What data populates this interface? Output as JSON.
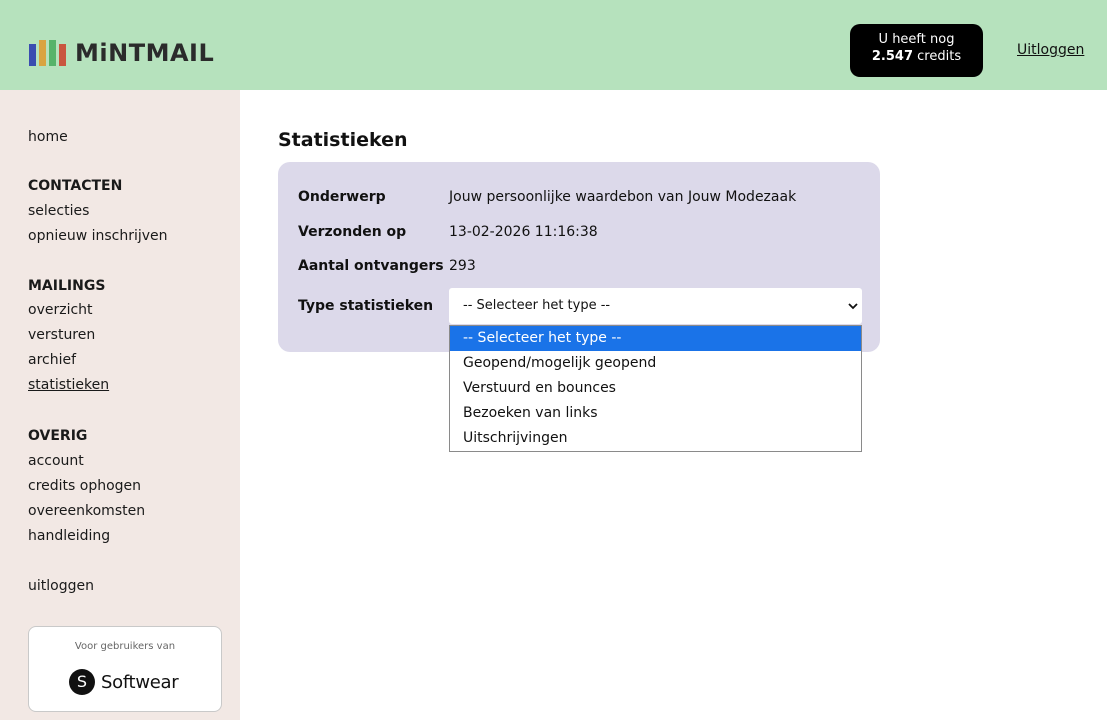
{
  "header": {
    "logo_text": "MiNTMAIL",
    "credits_line1": "U heeft nog",
    "credits_amount": "2.547",
    "credits_unit": "credits",
    "logout_label": "Uitloggen",
    "background_color": "#b6e2bd"
  },
  "sidebar": {
    "home": "home",
    "contacten_heading": "CONTACTEN",
    "contacten_items": [
      "selecties",
      "opnieuw inschrijven"
    ],
    "mailings_heading": "MAILINGS",
    "mailings_items": [
      "overzicht",
      "versturen",
      "archief",
      "statistieken"
    ],
    "overig_heading": "OVERIG",
    "overig_items": [
      "account",
      "credits ophogen",
      "overeenkomsten",
      "handleiding"
    ],
    "logout": "uitloggen",
    "active_item": "statistieken",
    "partner_caption": "Voor gebruikers van",
    "partner_icon_letter": "S",
    "partner_name": "Softwear"
  },
  "main": {
    "title": "Statistieken",
    "fields": [
      {
        "label": "Onderwerp",
        "value": "Jouw persoonlijke waardebon van Jouw Modezaak"
      },
      {
        "label": "Verzonden op",
        "value": "13-02-2026 11:16:38"
      },
      {
        "label": "Aantal ontvangers",
        "value": "293"
      }
    ],
    "type_label": "Type statistieken",
    "select": {
      "selected": "-- Selecteer het type --",
      "options": [
        "-- Selecteer het type --",
        "Geopend/mogelijk geopend",
        "Verstuurd en bounces",
        "Bezoeken van links",
        "Uitschrijvingen"
      ]
    }
  }
}
